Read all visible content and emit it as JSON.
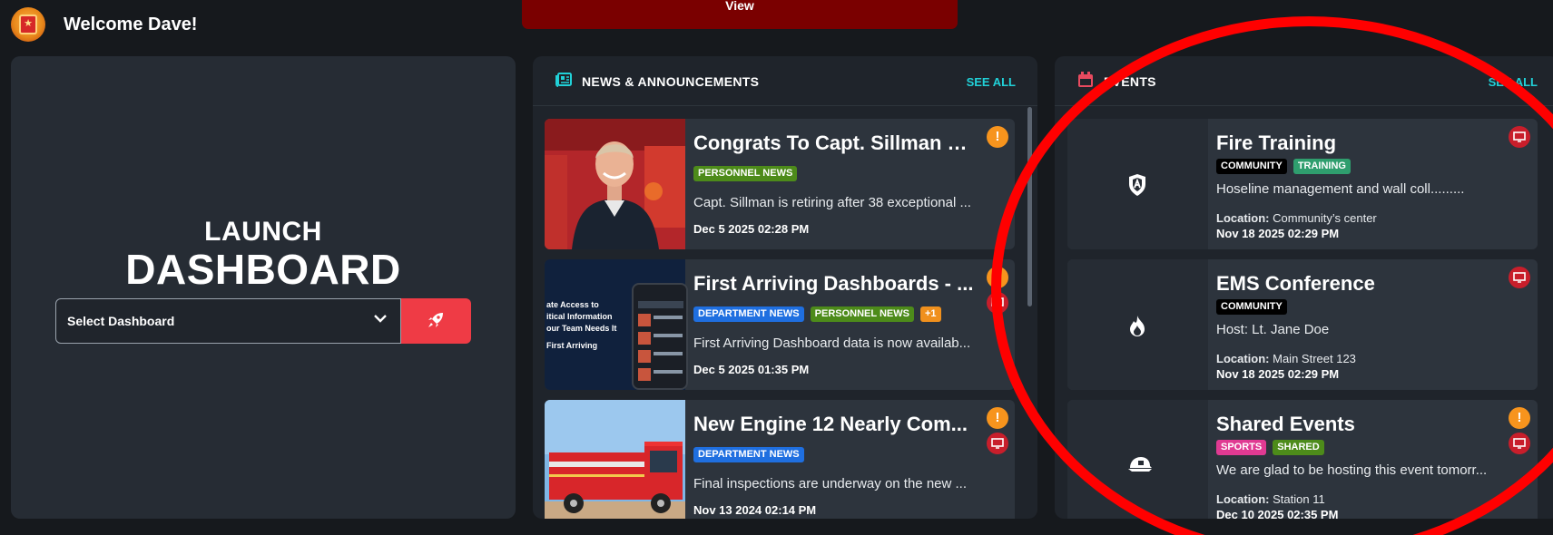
{
  "header": {
    "welcome": "Welcome Dave!",
    "view_label": "View"
  },
  "launch": {
    "line1": "LAUNCH",
    "line2": "DASHBOARD",
    "select_value": "Select Dashboard"
  },
  "news": {
    "title": "NEWS & ANNOUNCEMENTS",
    "see_all": "SEE ALL",
    "items": [
      {
        "title": "Congrats To Capt. Sillman O...",
        "tags": [
          "PERSONNEL NEWS"
        ],
        "desc": "Capt. Sillman is retiring after 38 exceptional ...",
        "date": "Dec 5 2025 02:28 PM",
        "warn": "!"
      },
      {
        "title": "First Arriving Dashboards - ...",
        "tags": [
          "DEPARTMENT NEWS",
          "PERSONNEL NEWS",
          "+1"
        ],
        "desc": "First Arriving Dashboard data is now availab...",
        "date": "Dec 5 2025 01:35 PM",
        "thumb_lines": [
          "ate Access to",
          "itical Information",
          "our Team Needs It",
          "First Arriving"
        ]
      },
      {
        "title": "New Engine 12 Nearly Com...",
        "tags": [
          "DEPARTMENT NEWS"
        ],
        "desc": "Final inspections are underway on the new ...",
        "date": "Nov 13 2024 02:14 PM",
        "warn": "!"
      }
    ]
  },
  "events": {
    "title": "EVENTS",
    "see_all": "SEE ALL",
    "location_label": "Location:",
    "items": [
      {
        "title": "Fire Training",
        "tags": [
          "COMMUNITY",
          "TRAINING"
        ],
        "desc": "Hoseline management and wall coll.........",
        "location": "Community’s center",
        "date": "Nov 18 2025 02:29 PM",
        "icon": "shield-icon"
      },
      {
        "title": "EMS Conference",
        "tags": [
          "COMMUNITY"
        ],
        "desc": "Host: Lt. Jane Doe",
        "location": "Main Street 123",
        "date": "Nov 18 2025 02:29 PM",
        "icon": "flame-icon"
      },
      {
        "title": "Shared Events",
        "tags": [
          "SPORTS",
          "SHARED"
        ],
        "desc": "We are glad to be hosting this event tomorr...",
        "location": "Station 11",
        "date": "Dec 10 2025 02:35 PM",
        "icon": "helmet-icon",
        "warn": "!"
      }
    ]
  },
  "colors": {
    "accent": "#21d1d8",
    "launch_button": "#ef3b45",
    "annotation_ring": "#ff0000"
  }
}
